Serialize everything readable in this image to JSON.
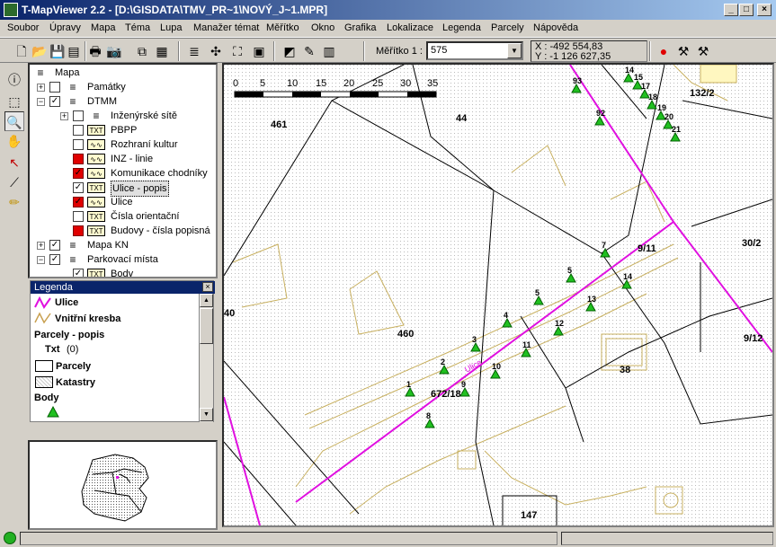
{
  "window": {
    "title": "T-MapViewer 2.2 - [D:\\GISDATA\\TMV_PR~1\\NOVÝ_J~1.MPR]",
    "minimize": "_",
    "restore": "□",
    "close": "×"
  },
  "menu": [
    "Soubor",
    "Úpravy",
    "Mapa",
    "Téma",
    "Lupa",
    "Manažer témat",
    "Měřítko",
    "Okno",
    "Grafika",
    "Lokalizace",
    "Legenda",
    "Parcely",
    "Nápověda"
  ],
  "toolbar": {
    "scale_label": "Měřítko 1 :",
    "scale_value": "575",
    "coord_x": "X : -492 554,83",
    "coord_y": "Y : -1 126 627,35",
    "icons": [
      "new-icon",
      "open-icon",
      "save-icon",
      "save-as-icon",
      "print-icon",
      "camera-icon",
      "copy-icon",
      "folder-icon",
      "stack-icon",
      "compress-icon",
      "expand-icon",
      "fit-icon",
      "edit-map-icon",
      "pencil-map-icon",
      "table-icon",
      "info-red-icon",
      "tools-icon",
      "hammer-icon"
    ]
  },
  "left_tools": [
    "info-icon",
    "select-area-icon",
    "zoom-icon",
    "pan-hand-icon",
    "pointer-info-icon",
    "polyline-icon",
    "pencil-icon"
  ],
  "tree": {
    "root": "Mapa",
    "items": [
      {
        "label": "Památky",
        "indent": 1,
        "expander": "+",
        "checked": "",
        "icon": "layers"
      },
      {
        "label": "DTMM",
        "indent": 1,
        "expander": "−",
        "checked": "✓",
        "icon": "layers"
      },
      {
        "label": "Inženýrské sítě",
        "indent": 2,
        "expander": "+",
        "checked": "",
        "icon": "layers"
      },
      {
        "label": "PBPP",
        "indent": 2,
        "expander": "",
        "checked": "",
        "icon": "TXT"
      },
      {
        "label": "Rozhraní kultur",
        "indent": 2,
        "expander": "",
        "checked": "",
        "icon": "line"
      },
      {
        "label": "INZ - linie",
        "indent": 2,
        "expander": "",
        "checked": "red",
        "icon": "line"
      },
      {
        "label": "Komunikace chodníky",
        "indent": 2,
        "expander": "",
        "checked": "red✓",
        "icon": "line"
      },
      {
        "label": "Ulice - popis",
        "indent": 2,
        "expander": "",
        "checked": "✓",
        "icon": "TXT"
      },
      {
        "label": "Ulice",
        "indent": 2,
        "expander": "",
        "checked": "red✓",
        "icon": "line"
      },
      {
        "label": "Čísla orientační",
        "indent": 2,
        "expander": "",
        "checked": "",
        "icon": "TXT"
      },
      {
        "label": "Budovy - čísla popisná",
        "indent": 2,
        "expander": "",
        "checked": "red",
        "icon": "TXT"
      },
      {
        "label": "Mapa KN",
        "indent": 1,
        "expander": "+",
        "checked": "✓",
        "icon": "layers"
      },
      {
        "label": "Parkovací místa",
        "indent": 1,
        "expander": "−",
        "checked": "✓",
        "icon": "layers"
      },
      {
        "label": "Body",
        "indent": 2,
        "expander": "",
        "checked": "✓",
        "icon": "TXT"
      }
    ]
  },
  "legend": {
    "title": "Legenda",
    "ulice": "Ulice",
    "vnitrni": "Vnitřní kresba",
    "parcely_popis": "Parcely - popis",
    "txt": "Txt",
    "txt_count": "(0)",
    "parcely": "Parcely",
    "katastry": "Katastry",
    "body": "Body"
  },
  "map": {
    "scalebar_ticks": [
      "0",
      "5",
      "10",
      "15",
      "20",
      "25",
      "30",
      "35"
    ],
    "parcel_labels": [
      "461",
      "44",
      "132/2",
      "9/11",
      "30/2",
      "460",
      "38",
      "672/18",
      "147",
      "9/12",
      "40"
    ],
    "point_labels": [
      "93",
      "92",
      "7",
      "5",
      "14",
      "5",
      "13",
      "4",
      "12",
      "3",
      "11",
      "2",
      "10",
      "1",
      "9",
      "8",
      "14",
      "15",
      "17",
      "18",
      "19",
      "20",
      "21"
    ],
    "street_label": "Ulice",
    "colors": {
      "street": "#e010e0",
      "inner": "#c8b060",
      "parcel": "#000000",
      "point": "#20c020"
    }
  }
}
